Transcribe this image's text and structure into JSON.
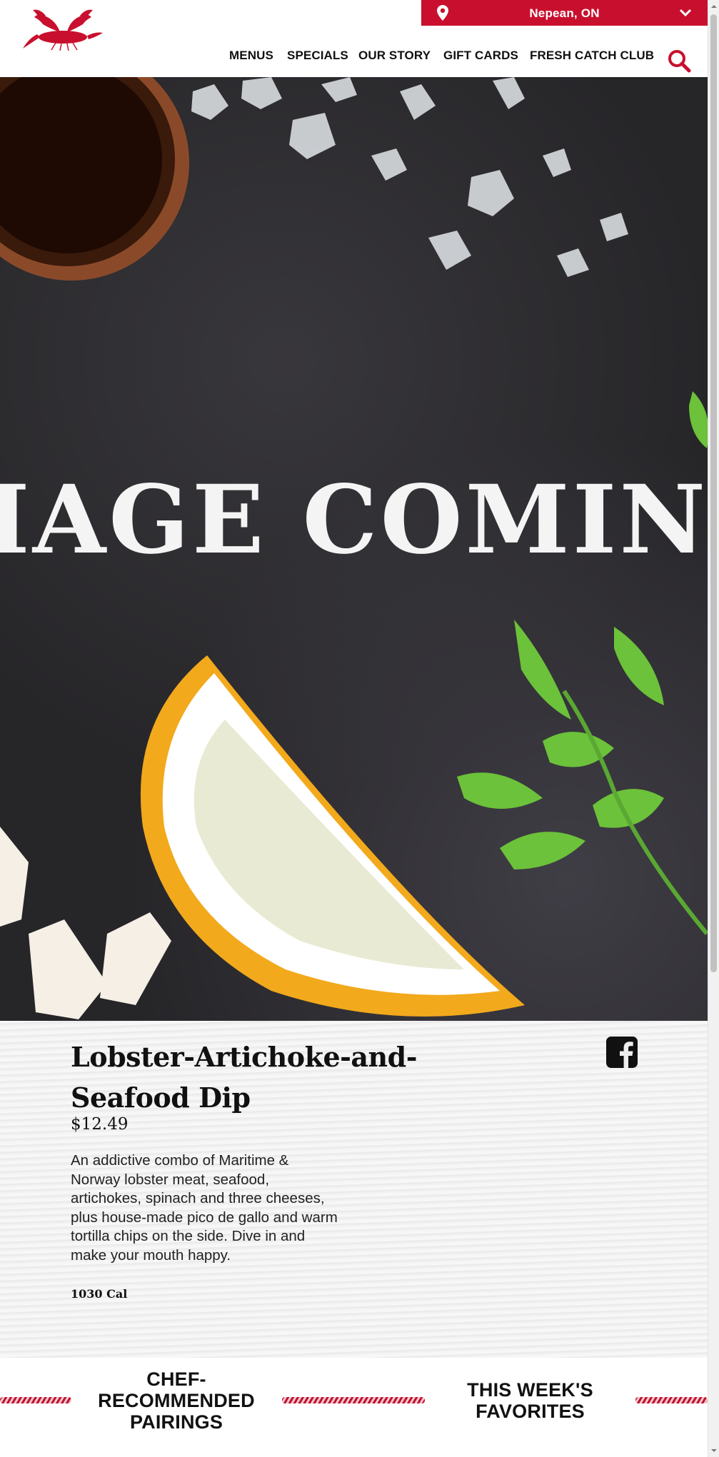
{
  "header": {
    "location": "Nepean, ON",
    "nav": [
      "MENUS",
      "SPECIALS",
      "OUR STORY",
      "GIFT CARDS",
      "FRESH CATCH CLUB"
    ]
  },
  "hero": {
    "banner_text": "IMAGE COMING SOON"
  },
  "item": {
    "title": "Lobster-Artichoke-and-Seafood Dip",
    "price": "$12.49",
    "description": "An addictive combo of Maritime & Norway lobster meat, seafood, artichokes, spinach and three cheeses, plus house-made pico de gallo and warm tortilla chips on the side. Dive in and make your mouth happy.",
    "calories": "1030 Cal"
  },
  "sections": {
    "pairings_heading": "CHEF-RECOMMENDED PAIRINGS",
    "favorites_heading": "THIS WEEK'S FAVORITES"
  },
  "icons": {
    "logo": "lobster-logo",
    "location": "map-pin-icon",
    "location_toggle": "chevron-down-icon",
    "search": "search-icon",
    "share": "facebook-icon"
  },
  "colors": {
    "brand_red": "#c8102e",
    "hero_background": "#262528",
    "details_background": "#eeeeee"
  }
}
